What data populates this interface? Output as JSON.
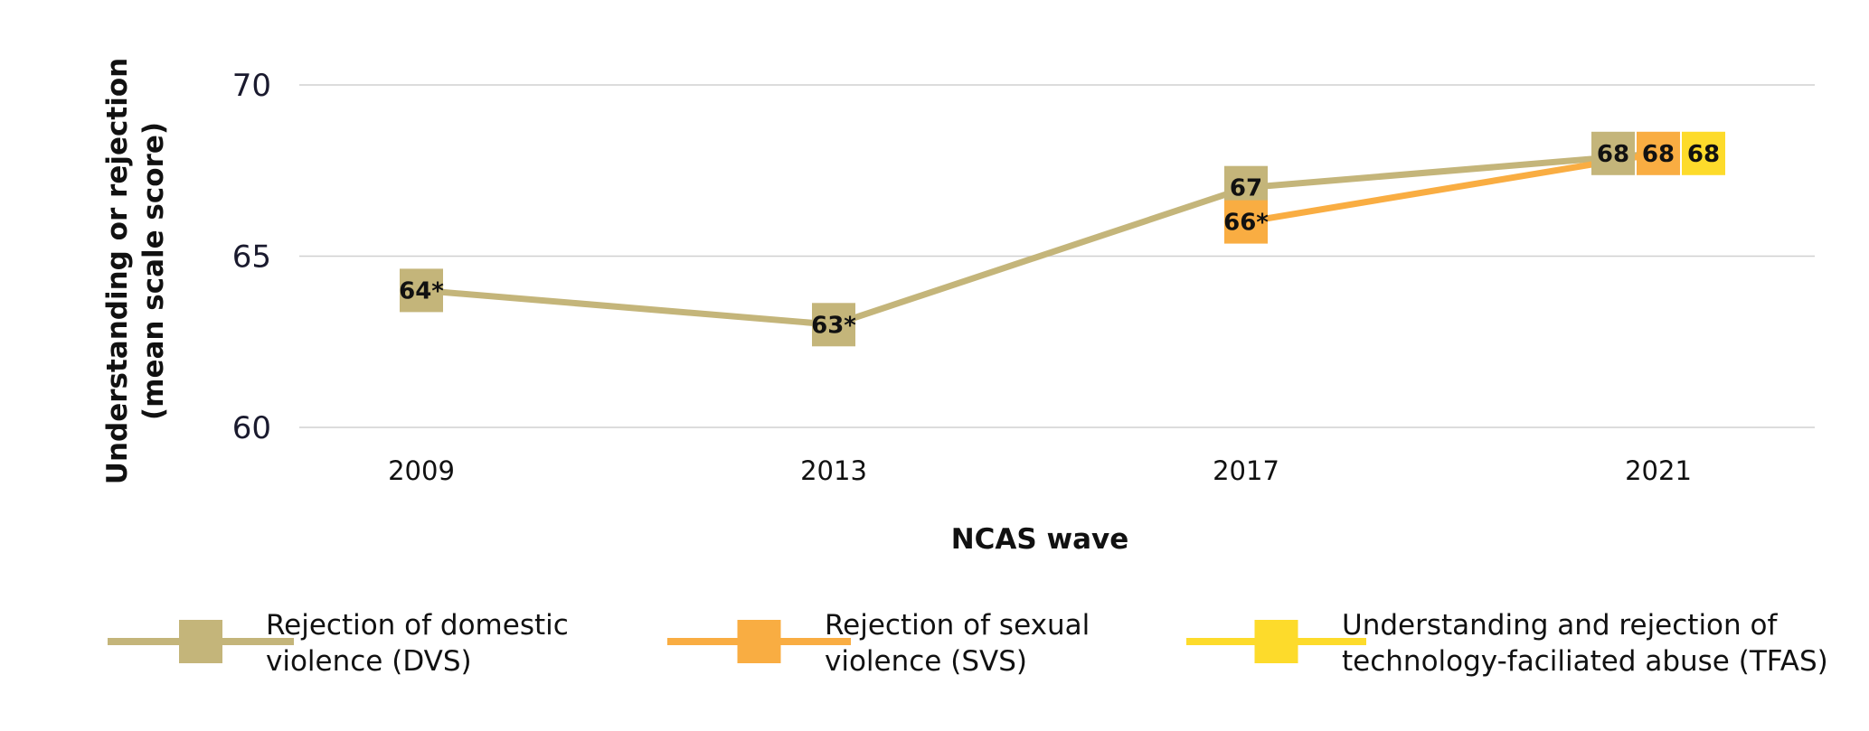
{
  "chart_data": {
    "type": "line",
    "xlabel": "NCAS wave",
    "ylabel_line1": "Understanding or rejection",
    "ylabel_line2": "(mean scale score)",
    "categories": [
      "2009",
      "2013",
      "2017",
      "2021"
    ],
    "ylim": [
      60,
      70
    ],
    "yticks": [
      "60",
      "65",
      "70"
    ],
    "grid": true,
    "legend_position": "bottom",
    "series": [
      {
        "name_line1": "Rejection of domestic",
        "name_line2": "violence (DVS)",
        "color": "#c4b57a",
        "values": [
          64,
          63,
          67,
          68
        ],
        "labels": [
          "64*",
          "63*",
          "67",
          "68"
        ]
      },
      {
        "name_line1": "Rejection of sexual",
        "name_line2": "violence (SVS)",
        "color": "#f9ad42",
        "values": [
          null,
          null,
          66,
          68
        ],
        "labels": [
          "",
          "",
          "66*",
          "68"
        ]
      },
      {
        "name_line1": "Understanding and rejection of",
        "name_line2": "technology-faciliated abuse (TFAS)",
        "color": "#fddb2b",
        "values": [
          null,
          null,
          null,
          68
        ],
        "labels": [
          "",
          "",
          "",
          "68"
        ]
      }
    ]
  }
}
